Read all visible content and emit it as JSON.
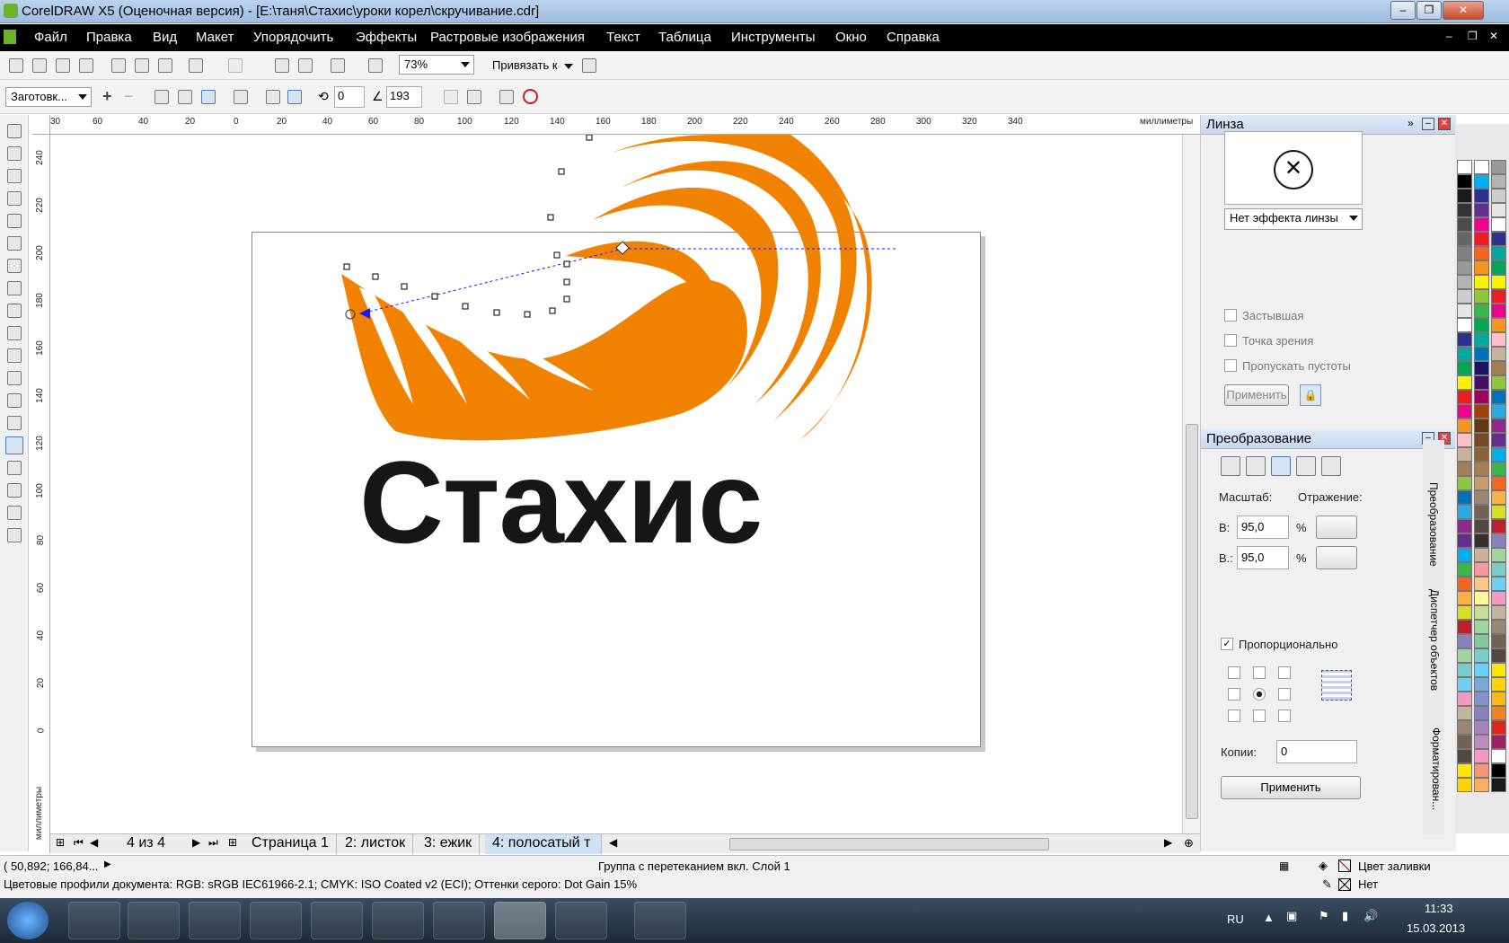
{
  "window": {
    "title": "CorelDRAW X5 (Оценочная версия) - [E:\\таня\\Стахис\\уроки корел\\скручивание.cdr]"
  },
  "menu": [
    "Файл",
    "Правка",
    "Вид",
    "Макет",
    "Упорядочить",
    "Эффекты",
    "Растровые изображения",
    "Текст",
    "Таблица",
    "Инструменты",
    "Окно",
    "Справка"
  ],
  "toolbar": {
    "zoom": "73%",
    "snap": "Привязать к"
  },
  "propbar": {
    "preset": "Заготовк...",
    "angle_value": "0",
    "twirl_value": "193"
  },
  "ruler": {
    "h_ticks": [
      "30",
      "60",
      "40",
      "20",
      "0",
      "20",
      "40",
      "60",
      "80",
      "100",
      "120",
      "140",
      "160",
      "180",
      "200",
      "220",
      "240",
      "260",
      "280",
      "300",
      "320",
      "340"
    ],
    "h_unit": "миллиметры",
    "v_ticks": [
      "240",
      "220",
      "200",
      "180",
      "160",
      "140",
      "120",
      "100",
      "80",
      "60",
      "40",
      "20",
      "0"
    ],
    "v_unit": "миллиметры"
  },
  "canvas": {
    "text": "Стахис",
    "logo_color": "#f08200"
  },
  "lens_docker": {
    "title": "Линза",
    "effect": "Нет эффекта линзы",
    "frozen": "Застывшая",
    "viewpoint": "Точка зрения",
    "remove_face": "Пропускать пустоты",
    "apply": "Применить"
  },
  "transform_docker": {
    "title": "Преобразование",
    "scale_label": "Масштаб:",
    "mirror_label": "Отражение:",
    "h_label": "В:",
    "v_label": "В.:",
    "h_value": "95,0",
    "v_value": "95,0",
    "percent": "%",
    "proportional": "Пропорционально",
    "copies_label": "Копии:",
    "copies_value": "0",
    "apply": "Применить"
  },
  "side_tabs": [
    "Преобразование",
    "Диспетчер объектов",
    "Форматирован..."
  ],
  "pagetabs": {
    "counter": "4 из 4",
    "tabs": [
      "Страница 1",
      "2: листок",
      "3: ежик",
      "4: полосатый т"
    ]
  },
  "status": {
    "coords": "( 50,892; 166,84... ",
    "selection": "Группа с перетеканием вкл. Слой 1",
    "profiles": "Цветовые профили документа: RGB: sRGB IEC61966-2.1; CMYK: ISO Coated v2 (ECI); Оттенки серого: Dot Gain 15%",
    "fill": "Цвет заливки",
    "outline": "Нет"
  },
  "taskbar": {
    "lang": "RU",
    "time": "11:33",
    "date": "15.03.2013"
  }
}
